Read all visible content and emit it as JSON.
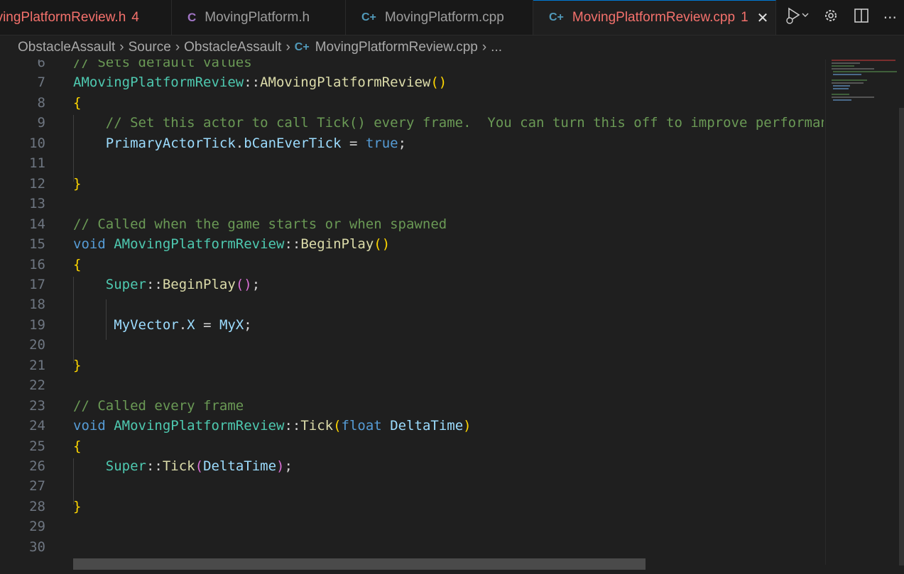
{
  "tabs": [
    {
      "label": "ovingPlatformReview.h",
      "badge": "4",
      "icon": "C",
      "icon_type": "header"
    },
    {
      "label": "MovingPlatform.h",
      "icon": "C",
      "icon_type": "c"
    },
    {
      "label": "MovingPlatform.cpp",
      "icon": "C+",
      "icon_type": "cpp"
    },
    {
      "label": "MovingPlatformReview.cpp",
      "badge": "1",
      "icon": "C+",
      "icon_type": "cpp",
      "active": true
    }
  ],
  "breadcrumb": [
    "ObstacleAssault",
    "Source",
    "ObstacleAssault",
    "MovingPlatformReview.cpp",
    "..."
  ],
  "breadcrumb_icon": "C+",
  "editor_actions": {
    "run_icon": "run-debug-icon",
    "settings_icon": "gear-icon",
    "split_icon": "split-editor-icon",
    "more_icon": "more-icon"
  },
  "code": {
    "lines": [
      {
        "n": "6",
        "tokens": [
          {
            "c": "cm",
            "t": "// Sets default values"
          }
        ]
      },
      {
        "n": "7",
        "tokens": [
          {
            "c": "ty",
            "t": "AMovingPlatformReview"
          },
          {
            "c": "op",
            "t": "::"
          },
          {
            "c": "fn",
            "t": "AMovingPlatformReview"
          },
          {
            "c": "b1",
            "t": "()"
          }
        ]
      },
      {
        "n": "8",
        "tokens": [
          {
            "c": "b1",
            "t": "{"
          }
        ]
      },
      {
        "n": "9",
        "tokens": [
          {
            "c": "cm",
            "t": "    // Set this actor to call Tick() every frame.  You can turn this off to improve performance if you don't need it."
          }
        ]
      },
      {
        "n": "10",
        "tokens": [
          {
            "c": "op",
            "t": "    "
          },
          {
            "c": "vr",
            "t": "PrimaryActorTick"
          },
          {
            "c": "op",
            "t": "."
          },
          {
            "c": "vr",
            "t": "bCanEverTick"
          },
          {
            "c": "op",
            "t": " = "
          },
          {
            "c": "kw",
            "t": "true"
          },
          {
            "c": "op",
            "t": ";"
          }
        ]
      },
      {
        "n": "11",
        "tokens": []
      },
      {
        "n": "12",
        "tokens": [
          {
            "c": "b1",
            "t": "}"
          }
        ]
      },
      {
        "n": "13",
        "tokens": []
      },
      {
        "n": "14",
        "tokens": [
          {
            "c": "cm",
            "t": "// Called when the game starts or when spawned"
          }
        ]
      },
      {
        "n": "15",
        "tokens": [
          {
            "c": "kw",
            "t": "void"
          },
          {
            "c": "op",
            "t": " "
          },
          {
            "c": "ty",
            "t": "AMovingPlatformReview"
          },
          {
            "c": "op",
            "t": "::"
          },
          {
            "c": "fn",
            "t": "BeginPlay"
          },
          {
            "c": "b1",
            "t": "()"
          }
        ]
      },
      {
        "n": "16",
        "tokens": [
          {
            "c": "b1",
            "t": "{"
          }
        ]
      },
      {
        "n": "17",
        "tokens": [
          {
            "c": "op",
            "t": "    "
          },
          {
            "c": "ty",
            "t": "Super"
          },
          {
            "c": "op",
            "t": "::"
          },
          {
            "c": "fn",
            "t": "BeginPlay"
          },
          {
            "c": "b2",
            "t": "()"
          },
          {
            "c": "op",
            "t": ";"
          }
        ]
      },
      {
        "n": "18",
        "tokens": []
      },
      {
        "n": "19",
        "tokens": [
          {
            "c": "op",
            "t": "     "
          },
          {
            "c": "vr",
            "t": "MyVector"
          },
          {
            "c": "op",
            "t": "."
          },
          {
            "c": "vr",
            "t": "X"
          },
          {
            "c": "op",
            "t": " = "
          },
          {
            "c": "vr",
            "t": "MyX"
          },
          {
            "c": "op",
            "t": ";"
          }
        ]
      },
      {
        "n": "20",
        "tokens": []
      },
      {
        "n": "21",
        "tokens": [
          {
            "c": "b1",
            "t": "}"
          }
        ]
      },
      {
        "n": "22",
        "tokens": []
      },
      {
        "n": "23",
        "tokens": [
          {
            "c": "cm",
            "t": "// Called every frame"
          }
        ]
      },
      {
        "n": "24",
        "tokens": [
          {
            "c": "kw",
            "t": "void"
          },
          {
            "c": "op",
            "t": " "
          },
          {
            "c": "ty",
            "t": "AMovingPlatformReview"
          },
          {
            "c": "op",
            "t": "::"
          },
          {
            "c": "fn",
            "t": "Tick"
          },
          {
            "c": "b1",
            "t": "("
          },
          {
            "c": "kw",
            "t": "float"
          },
          {
            "c": "op",
            "t": " "
          },
          {
            "c": "vr",
            "t": "DeltaTime"
          },
          {
            "c": "b1",
            "t": ")"
          }
        ]
      },
      {
        "n": "25",
        "tokens": [
          {
            "c": "b1",
            "t": "{"
          }
        ]
      },
      {
        "n": "26",
        "tokens": [
          {
            "c": "op",
            "t": "    "
          },
          {
            "c": "ty",
            "t": "Super"
          },
          {
            "c": "op",
            "t": "::"
          },
          {
            "c": "fn",
            "t": "Tick"
          },
          {
            "c": "b2",
            "t": "("
          },
          {
            "c": "vr",
            "t": "DeltaTime"
          },
          {
            "c": "b2",
            "t": ")"
          },
          {
            "c": "op",
            "t": ";"
          }
        ]
      },
      {
        "n": "27",
        "tokens": []
      },
      {
        "n": "28",
        "tokens": [
          {
            "c": "b1",
            "t": "}"
          }
        ]
      },
      {
        "n": "29",
        "tokens": []
      },
      {
        "n": "30",
        "tokens": []
      }
    ]
  }
}
